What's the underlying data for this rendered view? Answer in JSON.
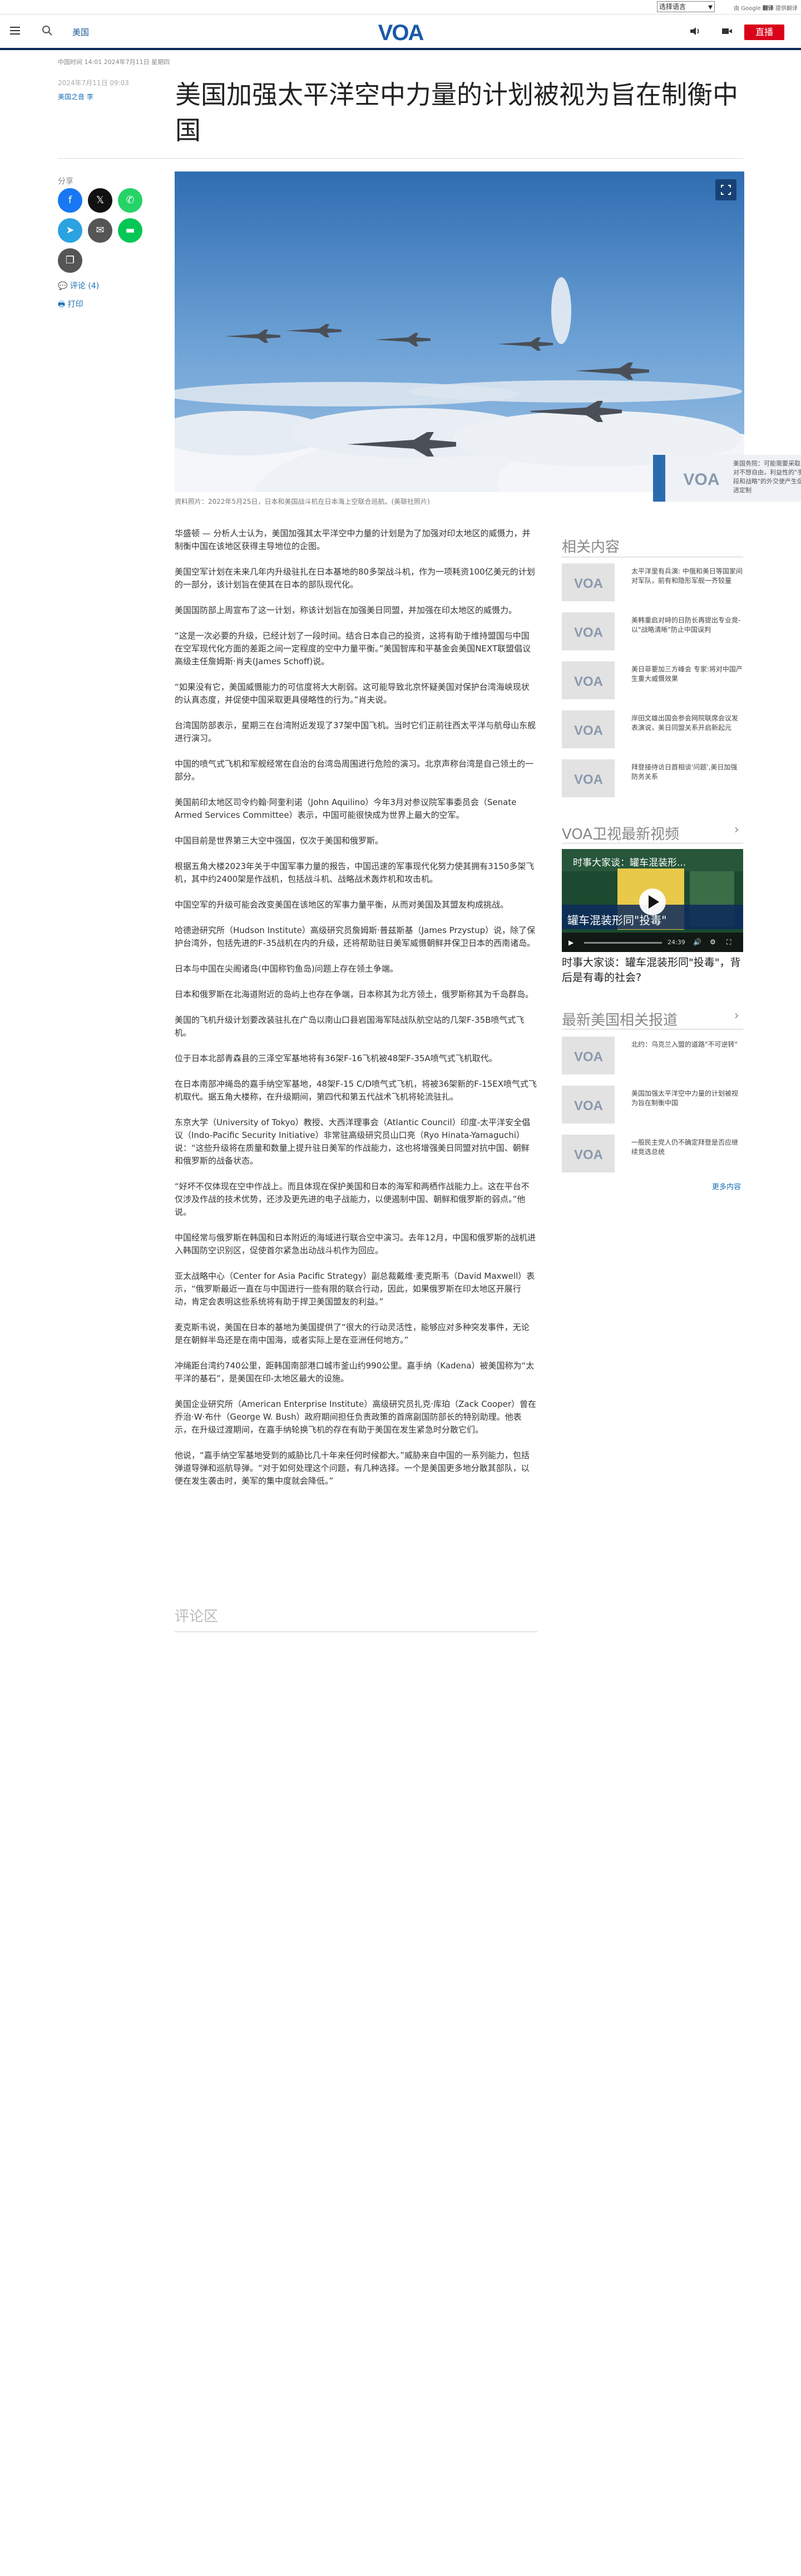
{
  "translate": {
    "select_label": "选择语言",
    "powered_by": "由 Google",
    "powered_brand": "翻译",
    "powered_suffix": "提供翻译"
  },
  "header": {
    "section": "美国",
    "logo_text": "VOA",
    "live_label": "直播"
  },
  "article": {
    "meta_line": "中国时间 14:01 2024年7月11日 星期四",
    "date_line": "2024年7月11日 09:03",
    "author": "美国之音 李",
    "title": "美国加强太平洋空中力量的计划被视为旨在制衡中国",
    "share_label": "分享",
    "comments_link": "评论 (4)",
    "print_link": "打印",
    "caption": "资料照片：2022年5月25日，日本和美国战斗机在日本海上空联合巡航。(美联社照片)",
    "paragraphs": [
      "华盛顿 — 分析人士认为，美国加强其太平洋空中力量的计划是为了加强对印太地区的威慑力，并制衡中国在该地区获得主导地位的企图。",
      "美国空军计划在未来几年内升级驻扎在日本基地的80多架战斗机，作为一项耗资100亿美元的计划的一部分，该计划旨在使其在日本的部队现代化。",
      "美国国防部上周宣布了这一计划，称该计划旨在加强美日同盟，并加强在印太地区的威慑力。",
      "“这是一次必要的升级，已经计划了一段时间。结合日本自己的投资，这将有助于维持盟国与中国在空军现代化方面的差距之间一定程度的空中力量平衡。”美国智库和平基金会美国NEXT联盟倡议高级主任詹姆斯·肖夫(James Schoff)说。",
      "“如果没有它，美国威慑能力的可信度将大大削弱。这可能导致北京怀疑美国对保护台湾海峡现状的认真态度，并促使中国采取更具侵略性的行为。”肖夫说。",
      "台湾国防部表示，星期三在台湾附近发现了37架中国飞机。当时它们正前往西太平洋与航母山东舰进行演习。",
      "中国的喷气式飞机和军舰经常在自治的台湾岛周围进行危险的演习。北京声称台湾是自己领土的一部分。",
      "美国前印太地区司令约翰·阿奎利诺（John Aquilino）今年3月对参议院军事委员会（Senate Armed Services Committee）表示，中国可能很快成为世界上最大的空军。",
      "中国目前是世界第三大空中强国，仅次于美国和俄罗斯。",
      "根据五角大楼2023年关于中国军事力量的报告，中国迅速的军事现代化努力使其拥有3150多架飞机，其中约2400架是作战机，包括战斗机、战略战术轰炸机和攻击机。",
      "中国空军的升级可能会改变美国在该地区的军事力量平衡，从而对美国及其盟友构成挑战。",
      "哈德逊研究所（Hudson Institute）高级研究员詹姆斯·普兹斯基（James Przystup）说，除了保护台湾外，包括先进的F-35战机在内的升级，还将帮助驻日美军威慑朝鲜并保卫日本的西南诸岛。",
      "日本与中国在尖阁诸岛(中国称钓鱼岛)问题上存在领土争端。",
      "日本和俄罗斯在北海道附近的岛屿上也存在争端，日本称其为北方领土，俄罗斯称其为千岛群岛。",
      "美国的飞机升级计划要改装驻扎在广岛以南山口县岩国海军陆战队航空站的几架F-35B喷气式飞机。",
      "位于日本北部青森县的三泽空军基地将有36架F-16飞机被48架F-35A喷气式飞机取代。",
      "在日本南部冲绳岛的嘉手纳空军基地，48架F-15 C/D喷气式飞机，将被36架新的F-15EX喷气式飞机取代。据五角大楼称，在升级期间，第四代和第五代战术飞机将轮流驻扎。",
      "东京大学（University of Tokyo）教授、大西洋理事会（Atlantic Council）印度-太平洋安全倡议（Indo-Pacific Security Initiative）非常驻高级研究员山口亮（Ryo Hinata-Yamaguchi）说：“这些升级将在质量和数量上提升驻日美军的作战能力，这也将增强美日同盟对抗中国、朝鲜和俄罗斯的战备状态。",
      "“好坏不仅体现在空中作战上。而且体现在保护美国和日本的海军和两栖作战能力上。这在平台不仅涉及作战的技术优势，还涉及更先进的电子战能力，以便遏制中国、朝鲜和俄罗斯的弱点。”他说。",
      "中国经常与俄罗斯在韩国和日本附近的海域进行联合空中演习。去年12月，中国和俄罗斯的战机进入韩国防空识别区，促使首尔紧急出动战斗机作为回应。",
      "亚太战略中心（Center for Asia Pacific Strategy）副总裁戴维·麦克斯韦（David Maxwell）表示，“俄罗斯最近一直在与中国进行一些有限的联合行动，因此，如果俄罗斯在印太地区开展行动，肯定会表明这些系统将有助于捍卫美国盟友的利益。”",
      "麦克斯韦说，美国在日本的基地为美国提供了“很大的行动灵活性，能够应对多种突发事件，无论是在朝鲜半岛还是在南中国海，或者实际上是在亚洲任何地方。”",
      "冲绳距台湾约740公里，距韩国南部港口城市釜山约990公里。嘉手纳（Kadena）被美国称为“太平洋的基石”，是美国在印-太地区最大的设施。",
      "美国企业研究所（American Enterprise Institute）高级研究员扎克·库珀（Zack Cooper）曾在乔治·W·布什（George W. Bush）政府期间担任负责政策的首席副国防部长的特别助理。他表示，在升级过渡期间，在嘉手纳轮换飞机的存在有助于美国在发生紧急时分散它们。",
      "他说，“嘉手纳空军基地受到的威胁比几十年来任何时候都大。”威胁来自中国的一系列能力，包括弹道导弹和巡航导弹。“对于如何处理这个问题，有几种选择。一个是美国更多地分散其部队，以便在发生袭击时，美军的集中度就会降低。”"
    ],
    "comments_heading": "评论区"
  },
  "sidebar": {
    "related_heading": "相关内容",
    "related": [
      "太平洋里有兵演: 中俄和美日等国家间对军队，前有和隐形军舰一齐较量",
      "美韩重启对峙的日防长再提出专业竞-以\"战略清晰\"防止中国误判",
      "美日菲要加三方峰会 专家:将对中国产生重大威慑效果",
      "岸田文雄出国会参会网院联席会议发表演说，美日同盟关系开启新起元",
      "拜登接待访日首相谈'问题',美日加强防务关系"
    ],
    "video_heading": "VOA卫视最新视频",
    "video_title": "时事大家谈：罐车混装形同\"投毒\"，背后是有毒的社会?",
    "video_overlay_title": "时事大家谈：罐车混装形...",
    "video_banner": "罐车混装形同\"投毒\"",
    "video_time": "24:39",
    "latest_heading": "最新美国相关报道",
    "latest": [
      "北约：乌克兰入盟的道路\"不可逆转\"",
      "美国加强太平洋空中力量的计划被视为旨在制衡中国",
      "一般民主党人仍不确定拜登是否应继续竞选总统"
    ],
    "more_link": "更多内容"
  },
  "float_card": {
    "text": "美国务院：可能需要采取对不想自由，利益性的\"手段和战略\"的外交使产生促进定制"
  },
  "colors": {
    "brand_navy": "#0c2a5c",
    "live_red": "#d9041b",
    "link_blue": "#1a6fb4"
  }
}
